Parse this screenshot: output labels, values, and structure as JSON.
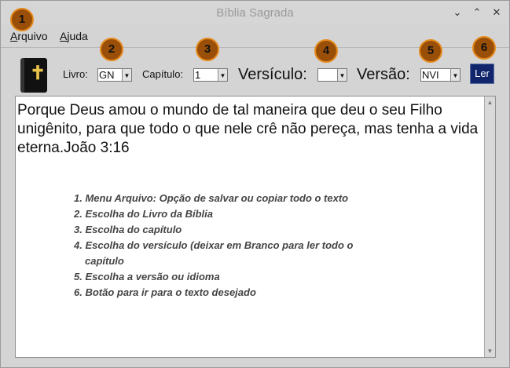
{
  "window": {
    "title": "Bíblia Sagrada",
    "controls": [
      "✕",
      "⌃",
      "⌄"
    ]
  },
  "menu": {
    "arquivo_first": "A",
    "arquivo_rest": "rquivo",
    "ajuda_first": "A",
    "ajuda_rest": "juda"
  },
  "badges": [
    "1",
    "2",
    "3",
    "4",
    "5",
    "6"
  ],
  "toolbar": {
    "livro_label": "Livro:",
    "livro_value": "GN",
    "capitulo_label": "Capítulo:",
    "capitulo_value": "1",
    "versiculo_label": "Versículo:",
    "versiculo_value": "",
    "versao_label": "Versão:",
    "versao_value": "NVI",
    "ler_label": "Ler"
  },
  "content": {
    "verse_text": "Porque Deus amou o mundo de tal maneira que deu o seu Filho unigênito, para que todo o que nele crê não pereça, mas tenha a vida eterna.João 3:16"
  },
  "instructions": [
    "1. Menu Arquivo: Opção de salvar ou copiar todo o texto",
    "2. Escolha do Livro da Bíblia",
    "3. Escolha do capítulo",
    "4. Escolha do versículo (deixar em Branco para ler todo o",
    "capítulo",
    "5. Escolha a versão ou idioma",
    "6. Botão para ir para o texto desejado"
  ],
  "colors": {
    "badge_fill": "#9a4f09",
    "badge_border": "#e58a1c",
    "ler_button": "#10256b"
  },
  "icons": {
    "bible": "bible-book-icon",
    "dropdown": "triangle-down"
  }
}
